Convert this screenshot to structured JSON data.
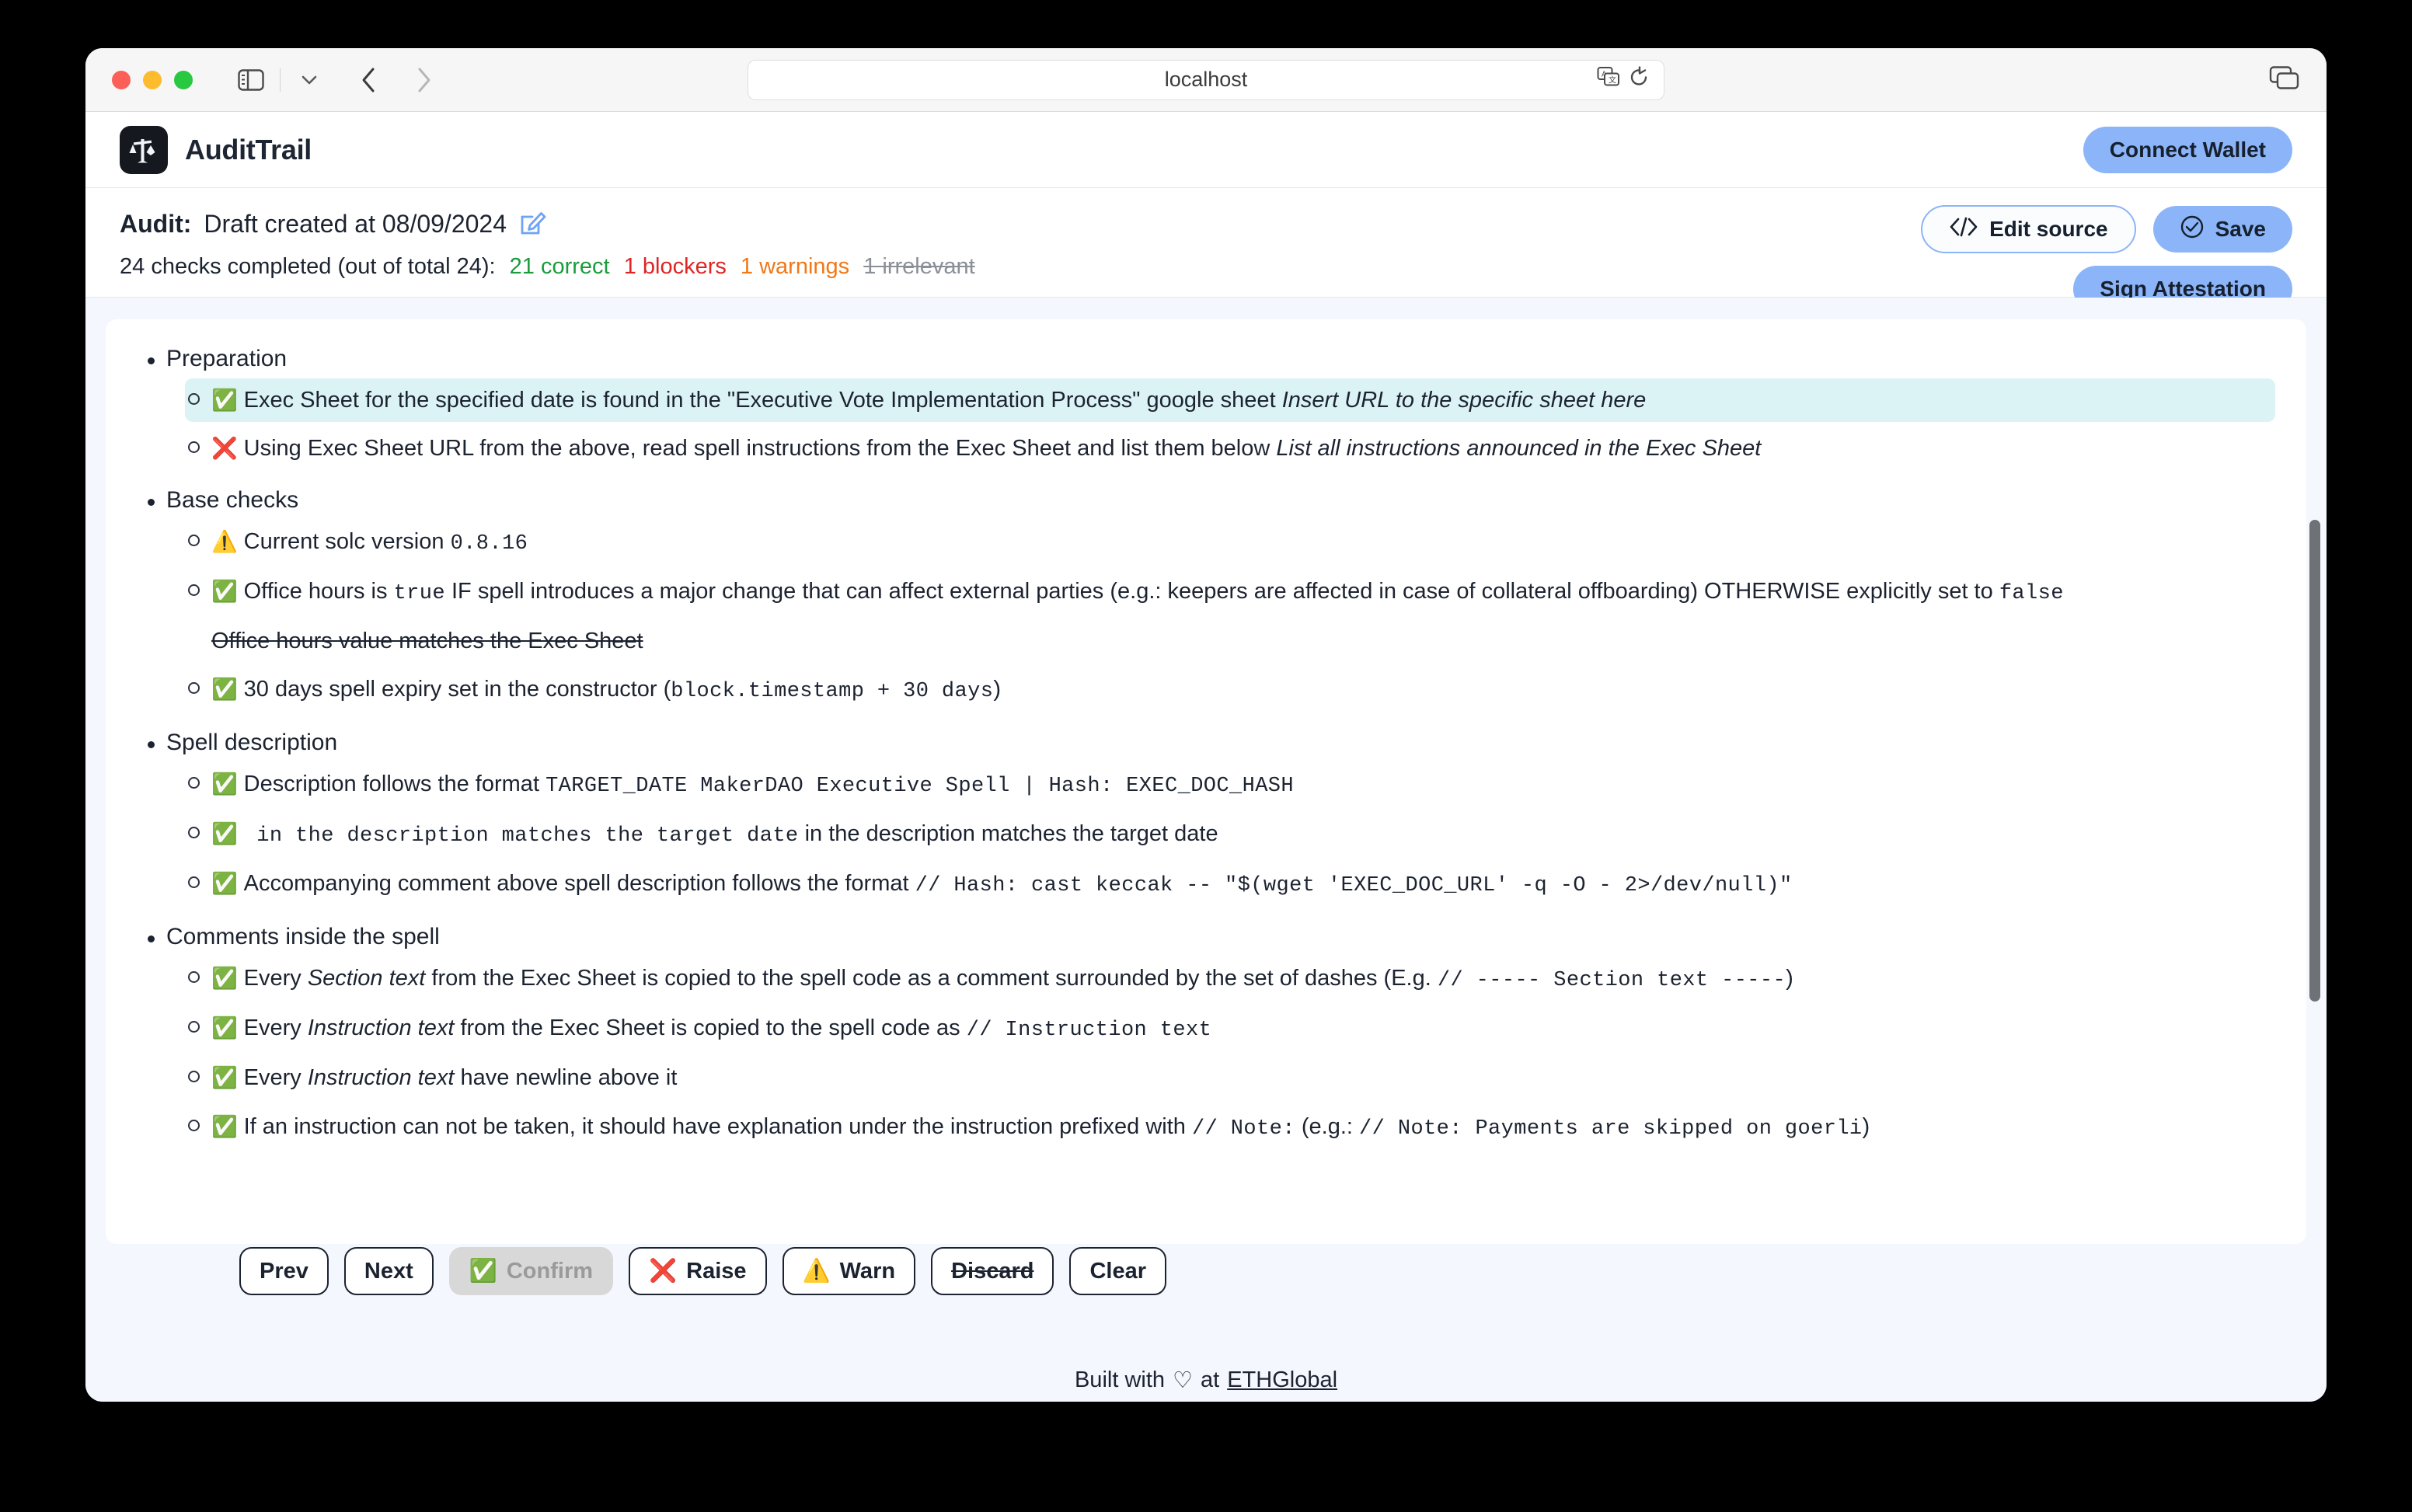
{
  "browser": {
    "url": "localhost",
    "icons": {
      "sidebar": "sidebar-icon",
      "chevron_down": "chevron-down-icon",
      "back": "back-arrow-icon",
      "forward": "forward-arrow-icon",
      "translate": "translate-icon",
      "reload": "reload-icon",
      "tabs": "tabs-overview-icon"
    }
  },
  "header": {
    "brand": "AuditTrail",
    "logo_icon": "scales-ethereum-logo",
    "connect_wallet": "Connect Wallet"
  },
  "audit": {
    "label": "Audit:",
    "title": "Draft created at 08/09/2024",
    "edit_icon": "pencil-edit-icon",
    "summary_prefix": "24 checks completed (out of total 24):",
    "stats": {
      "correct": "21 correct",
      "blockers": "1 blockers",
      "warnings": "1 warnings",
      "irrelevant": "1 irrelevant"
    },
    "buttons": {
      "edit_source": "Edit source",
      "save": "Save",
      "sign_attestation": "Sign Attestation"
    },
    "colors": {
      "accent": "#8cb4f8",
      "correct": "#1a9c3c",
      "blocker": "#e02424",
      "warning": "#f07818",
      "irrelevant": "#8b8f98",
      "selected_row": "#dcf3f5"
    }
  },
  "checklist": [
    {
      "section": "Preparation",
      "items": [
        {
          "status": "correct",
          "icon": "✅",
          "selected": true,
          "parts": [
            {
              "t": "text",
              "v": "Exec Sheet for the specified date is found in the \"Executive Vote Implementation Process\" google sheet "
            },
            {
              "t": "em",
              "v": "Insert URL to the specific sheet here"
            }
          ]
        },
        {
          "status": "blocker",
          "icon": "❌",
          "parts": [
            {
              "t": "text",
              "v": "Using Exec Sheet URL from the above, read spell instructions from the Exec Sheet and list them below "
            },
            {
              "t": "em",
              "v": "List all instructions announced in the Exec Sheet"
            }
          ]
        }
      ]
    },
    {
      "section": "Base checks",
      "items": [
        {
          "status": "warning",
          "icon": "⚠️",
          "parts": [
            {
              "t": "text",
              "v": "Current solc version "
            },
            {
              "t": "code",
              "v": "0.8.16"
            }
          ]
        },
        {
          "status": "correct",
          "icon": "✅",
          "parts": [
            {
              "t": "text",
              "v": "Office hours is "
            },
            {
              "t": "code",
              "v": "true"
            },
            {
              "t": "text",
              "v": " IF spell introduces a major change that can affect external parties (e.g.: keepers are affected in case of collateral offboarding) OTHERWISE explicitly set to "
            },
            {
              "t": "code",
              "v": "false"
            }
          ]
        },
        {
          "status": "irrelevant",
          "icon": "",
          "struck": true,
          "no_marker": true,
          "parts": [
            {
              "t": "text",
              "v": "Office hours value matches the Exec Sheet"
            }
          ]
        },
        {
          "status": "correct",
          "icon": "✅",
          "parts": [
            {
              "t": "text",
              "v": "30 days spell expiry set in the constructor ("
            },
            {
              "t": "code",
              "v": "block.timestamp + 30 days"
            },
            {
              "t": "text",
              "v": ")"
            }
          ]
        }
      ]
    },
    {
      "section": "Spell description",
      "items": [
        {
          "status": "correct",
          "icon": "✅",
          "parts": [
            {
              "t": "text",
              "v": "Description follows the format "
            },
            {
              "t": "code",
              "v": "TARGET_DATE MakerDAO Executive Spell | Hash: EXEC_DOC_HASH"
            }
          ]
        },
        {
          "status": "correct",
          "icon": "✅",
          "parts": [
            {
              "t": "code",
              "v": " in the description matches the target date"
            },
            {
              "t": "text",
              "v": " in the description matches the target date"
            }
          ]
        },
        {
          "status": "correct",
          "icon": "✅",
          "parts": [
            {
              "t": "text",
              "v": "Accompanying comment above spell description follows the format "
            },
            {
              "t": "code",
              "v": "// Hash: cast keccak -- \"$(wget 'EXEC_DOC_URL' -q -O - 2>/dev/null)\""
            }
          ]
        }
      ]
    },
    {
      "section": "Comments inside the spell",
      "items": [
        {
          "status": "correct",
          "icon": "✅",
          "parts": [
            {
              "t": "text",
              "v": "Every "
            },
            {
              "t": "em",
              "v": "Section text"
            },
            {
              "t": "text",
              "v": " from the Exec Sheet is copied to the spell code as a comment surrounded by the set of dashes (E.g. "
            },
            {
              "t": "code",
              "v": "// ----- Section text -----"
            },
            {
              "t": "text",
              "v": ")"
            }
          ]
        },
        {
          "status": "correct",
          "icon": "✅",
          "parts": [
            {
              "t": "text",
              "v": "Every "
            },
            {
              "t": "em",
              "v": "Instruction text"
            },
            {
              "t": "text",
              "v": " from the Exec Sheet is copied to the spell code as "
            },
            {
              "t": "code",
              "v": "// Instruction text"
            }
          ]
        },
        {
          "status": "correct",
          "icon": "✅",
          "parts": [
            {
              "t": "text",
              "v": "Every "
            },
            {
              "t": "em",
              "v": "Instruction text"
            },
            {
              "t": "text",
              "v": " have newline above it"
            }
          ]
        },
        {
          "status": "correct",
          "icon": "✅",
          "parts": [
            {
              "t": "text",
              "v": "If an instruction can not be taken, it should have explanation under the instruction prefixed with "
            },
            {
              "t": "code",
              "v": "// Note:"
            },
            {
              "t": "text",
              "v": " (e.g.: "
            },
            {
              "t": "code",
              "v": "// Note: Payments are skipped on goerli"
            },
            {
              "t": "text",
              "v": ")"
            }
          ]
        }
      ]
    }
  ],
  "bottom_toolbar": [
    {
      "label": "Prev",
      "icon": "",
      "state": "enabled"
    },
    {
      "label": "Next",
      "icon": "",
      "state": "enabled"
    },
    {
      "label": "Confirm",
      "icon": "✅",
      "state": "disabled"
    },
    {
      "label": "Raise",
      "icon": "❌",
      "state": "enabled"
    },
    {
      "label": "Warn",
      "icon": "⚠️",
      "state": "enabled"
    },
    {
      "label": "Discard",
      "icon": "",
      "state": "enabled",
      "struck": true
    },
    {
      "label": "Clear",
      "icon": "",
      "state": "enabled"
    }
  ],
  "footer": {
    "prefix": "Built with",
    "heart": "♡",
    "middle": "at",
    "link": "ETHGlobal"
  }
}
